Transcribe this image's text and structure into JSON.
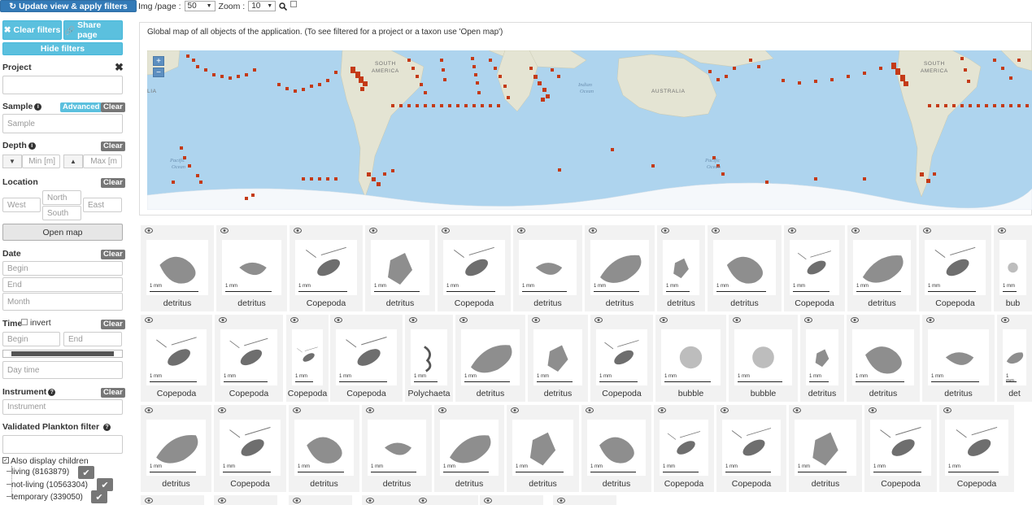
{
  "toolbar": {
    "update_label": "Update view & apply filters",
    "img_page_label": "Img /page :",
    "img_page_value": "50",
    "zoom_label": "Zoom :",
    "zoom_value": "10"
  },
  "filters": {
    "clear_filters_label": "Clear filters",
    "share_page_label": "Share page",
    "hide_filters_label": "Hide filters",
    "project_label": "Project",
    "project_value": "",
    "sample_label": "Sample",
    "advanced_label": "Advanced",
    "clear_label": "Clear",
    "sample_placeholder": "Sample",
    "depth_label": "Depth",
    "depth_min_placeholder": "Min [m]",
    "depth_max_placeholder": "Max [m",
    "location_label": "Location",
    "west_placeholder": "West",
    "north_placeholder": "North",
    "east_placeholder": "East",
    "south_placeholder": "South",
    "open_map_label": "Open map",
    "date_label": "Date",
    "begin_placeholder": "Begin",
    "end_placeholder": "End",
    "month_placeholder": "Month",
    "time_label": "Time",
    "invert_label": "invert",
    "time_begin_placeholder": "Begin",
    "time_end_placeholder": "End",
    "day_time_placeholder": "Day time",
    "instrument_label": "Instrument",
    "instrument_placeholder": "Instrument",
    "validated_label": "Validated Plankton filter",
    "also_display_children_label": "Also display children",
    "tree": [
      {
        "label": "living (8163879)"
      },
      {
        "label": "not-living (10563304)"
      },
      {
        "label": "temporary (339050)"
      }
    ]
  },
  "map": {
    "caption": "Global map of all objects of the application. (To see filtered for a project or a taxon use 'Open map')",
    "zoom_in": "+",
    "zoom_out": "−",
    "place_labels": {
      "south_america_1": "SOUTH",
      "south_america_1b": "AMERICA",
      "australia": "AUSTRALIA",
      "indian_ocean": "Indian",
      "indian_ocean_b": "Ocean",
      "pacific_1": "Pacific",
      "pacific_1b": "Ocean",
      "lia": "LIA",
      "south_america_2": "SOUTH",
      "south_america_2b": "AMERICA",
      "pacific_2": "Pacific",
      "pacific_2b": "Ocean"
    },
    "water_color": "#aed4ee",
    "land_color": "#e4e4d3",
    "point_color": "#c43a17"
  },
  "thumbnails": {
    "scale_label": "1 mm",
    "row1": [
      {
        "label": "detritus"
      },
      {
        "label": "detritus"
      },
      {
        "label": "Copepoda"
      },
      {
        "label": "detritus"
      },
      {
        "label": "Copepoda"
      },
      {
        "label": "detritus"
      },
      {
        "label": "detritus"
      },
      {
        "label": "detritus"
      },
      {
        "label": "detritus"
      },
      {
        "label": "Copepoda"
      },
      {
        "label": "detritus"
      },
      {
        "label": "Copepoda"
      },
      {
        "label": "bub"
      }
    ],
    "row2": [
      {
        "label": "Copepoda"
      },
      {
        "label": "Copepoda"
      },
      {
        "label": "Copepoda"
      },
      {
        "label": "Copepoda"
      },
      {
        "label": "Polychaeta"
      },
      {
        "label": "detritus"
      },
      {
        "label": "detritus"
      },
      {
        "label": "Copepoda"
      },
      {
        "label": "bubble"
      },
      {
        "label": "bubble"
      },
      {
        "label": "detritus"
      },
      {
        "label": "detritus"
      },
      {
        "label": "detritus"
      },
      {
        "label": "det"
      }
    ],
    "row3": [
      {
        "label": "detritus"
      },
      {
        "label": "Copepoda"
      },
      {
        "label": "detritus"
      },
      {
        "label": "detritus"
      },
      {
        "label": "detritus"
      },
      {
        "label": "detritus"
      },
      {
        "label": "detritus"
      },
      {
        "label": "Copepoda"
      },
      {
        "label": "Copepoda"
      },
      {
        "label": "detritus"
      },
      {
        "label": "Copepoda"
      },
      {
        "label": "Copepoda"
      }
    ]
  }
}
